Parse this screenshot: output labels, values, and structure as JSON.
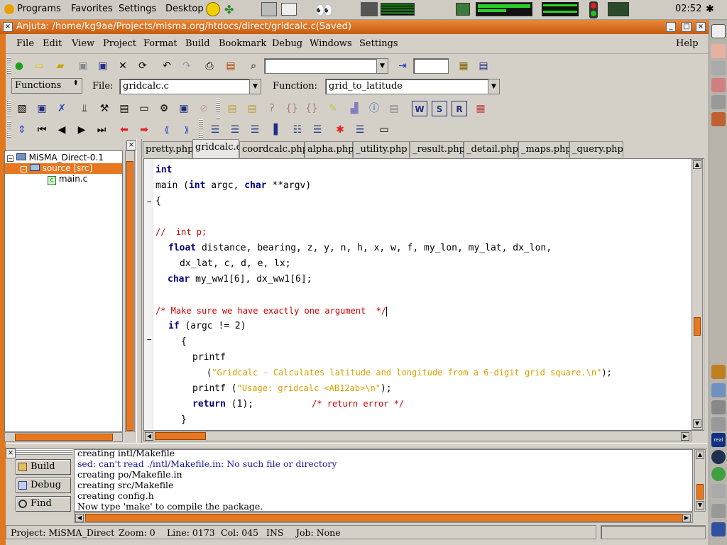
{
  "panel": {
    "programs": "Programs",
    "favorites": "Favorites",
    "settings": "Settings",
    "desktop": "Desktop",
    "clock": "02:52"
  },
  "window": {
    "title": "Anjuta: /home/kg9ae/Projects/misma.org/htdocs/direct/gridcalc.c(Saved)"
  },
  "menu": {
    "file": "File",
    "edit": "Edit",
    "view": "View",
    "project": "Project",
    "format": "Format",
    "build": "Build",
    "bookmark": "Bookmark",
    "debug": "Debug",
    "windows": "Windows",
    "settings": "Settings",
    "help": "Help"
  },
  "toolbar": {
    "search_value": "",
    "goto_line_value": "",
    "functions_label": "Functions",
    "file_label": "File:",
    "file_value": "gridcalc.c",
    "function_label": "Function:",
    "function_value": "grid_to_latitude"
  },
  "tree": {
    "root": "MiSMA_Direct-0.1",
    "folder": "source [src]",
    "file": "main.c"
  },
  "tabs": [
    "pretty.php",
    "gridcalc.c",
    "coordcalc.php",
    "alpha.php",
    "_utility.php",
    "_result.php",
    "_detail.php",
    "_maps.php",
    "_query.php"
  ],
  "code": {
    "l1": "int",
    "l2_fn": "main (",
    "l2_kw1": "int",
    "l2_mid": " argc, ",
    "l2_kw2": "char",
    "l2_end": " **argv)",
    "l3": "{",
    "l5": "//  int p;",
    "l6_kw": "float",
    "l6_rest": " distance, bearing, z, y, n, h, x, w, f, my_lon, my_lat, dx_lon,",
    "l7": "dx_lat, c, d, e, lx;",
    "l8_kw": "char",
    "l8_rest": " my_ww1[6], dx_ww1[6];",
    "l10": "/* Make sure we have exactly one argument  */",
    "l11_kw": "if",
    "l11_rest": " (argc != 2)",
    "l12": "{",
    "l13": "printf",
    "l14_open": "(",
    "l14_str": "\"Gridcalc - Calculates latitude and longitude from a 6-digit grid square.\\n\"",
    "l14_close": ");",
    "l15_fn": "printf (",
    "l15_str": "\"Usage: gridcalc <AB12ab>\\n\"",
    "l15_close": ");",
    "l16_kw": "return",
    "l16_rest": " (1);",
    "l16_cm": "/* return error */",
    "l17": "}"
  },
  "side_buttons": {
    "build": "Build",
    "debug": "Debug",
    "find": "Find"
  },
  "messages": [
    "creating intl/Makefile",
    "sed: can't read ./intl/Makefile.in: No such file or directory",
    "creating po/Makefile.in",
    "creating src/Makefile",
    "creating config.h",
    "Now type 'make' to compile the package."
  ],
  "status": {
    "project": "Project: MiSMA_Direct",
    "zoom": "Zoom: 0",
    "line": "Line: 0173",
    "col": "Col: 045",
    "mode": "INS",
    "job": "Job: None"
  },
  "colors": {
    "accent": "#e07820",
    "keyword": "#000080",
    "comment": "#cc0000",
    "string": "#d8a000",
    "error_msg": "#1a1aa0"
  }
}
